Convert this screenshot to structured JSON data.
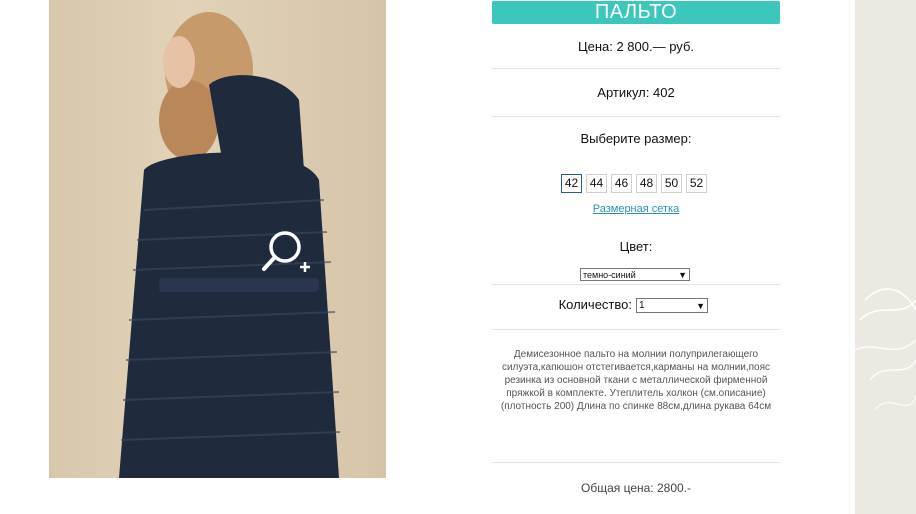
{
  "product": {
    "title": "ПАЛЬТО",
    "price": "Цена: 2 800.— руб.",
    "article": "Артикул: 402",
    "size_prompt": "Выберите размер:",
    "sizes": [
      "42",
      "44",
      "46",
      "48",
      "50",
      "52"
    ],
    "selected_size": "42",
    "size_chart_link": "Размерная сетка",
    "color_label": "Цвет:",
    "color_value": "темно-синий",
    "quantity_label": "Количество:",
    "quantity_value": "1",
    "description": "Демисезонное пальто на молнии полуприлегающего силуэта,капюшон отстегивается,карманы на молнии,пояс резинка из основной ткани с металлической фирменной пряжкой в комплекте. Утеплитель холкон (см.описание) (плотность 200) Длина по спинке 88см,длина рукава 64см",
    "total": "Общая цена: 2800.-"
  },
  "colors": {
    "accent": "#3cc7bd",
    "link": "#2f8fb3",
    "coat": "#1f2a3d"
  },
  "icons": {
    "zoom": "zoom-in-icon"
  }
}
